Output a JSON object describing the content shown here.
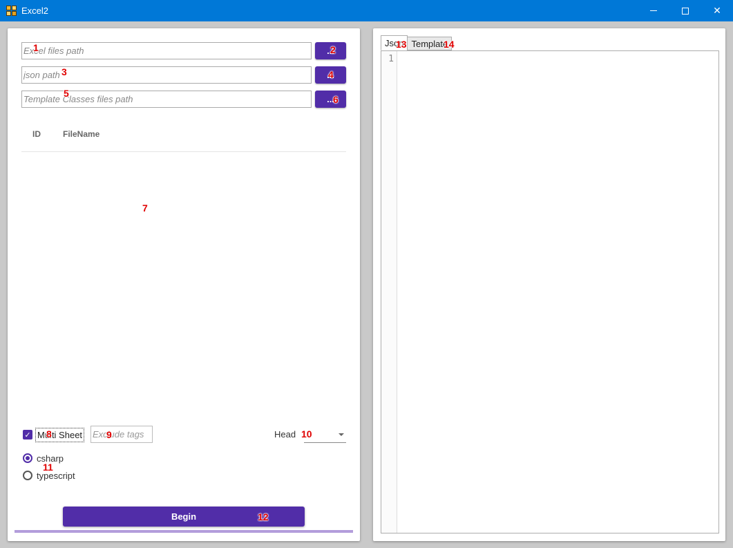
{
  "window": {
    "title": "Excel2",
    "minimize_icon": "minimize-icon",
    "maximize_icon": "maximize-icon",
    "close_symbol": "✕"
  },
  "paths": [
    {
      "placeholder": "Excel files path",
      "button_label": "..."
    },
    {
      "placeholder": "json path",
      "button_label": "..."
    },
    {
      "placeholder": "Template Classes files path",
      "button_label": "..."
    }
  ],
  "file_table": {
    "columns": [
      "ID",
      "FileName"
    ],
    "rows": []
  },
  "options": {
    "multi_sheet_label": "Multi Sheet",
    "multi_sheet_checked": true,
    "exclude_placeholder": "Exclude tags",
    "head_label": "Head",
    "head_value": "",
    "languages": [
      {
        "label": "csharp",
        "selected": true
      },
      {
        "label": "typescript",
        "selected": false
      }
    ],
    "begin_label": "Begin",
    "progress": 0
  },
  "right_pane": {
    "tabs": [
      "Json",
      "Template"
    ],
    "active_tab": "Json",
    "line_numbers": [
      "1"
    ]
  },
  "markers": [
    "1",
    "2",
    "3",
    "4",
    "5",
    "6",
    "7",
    "8",
    "9",
    "10",
    "11",
    "12",
    "13",
    "14"
  ],
  "colors": {
    "accent": "#512da8",
    "accent_light": "#b39ddb",
    "titlebar": "#0078d7"
  }
}
